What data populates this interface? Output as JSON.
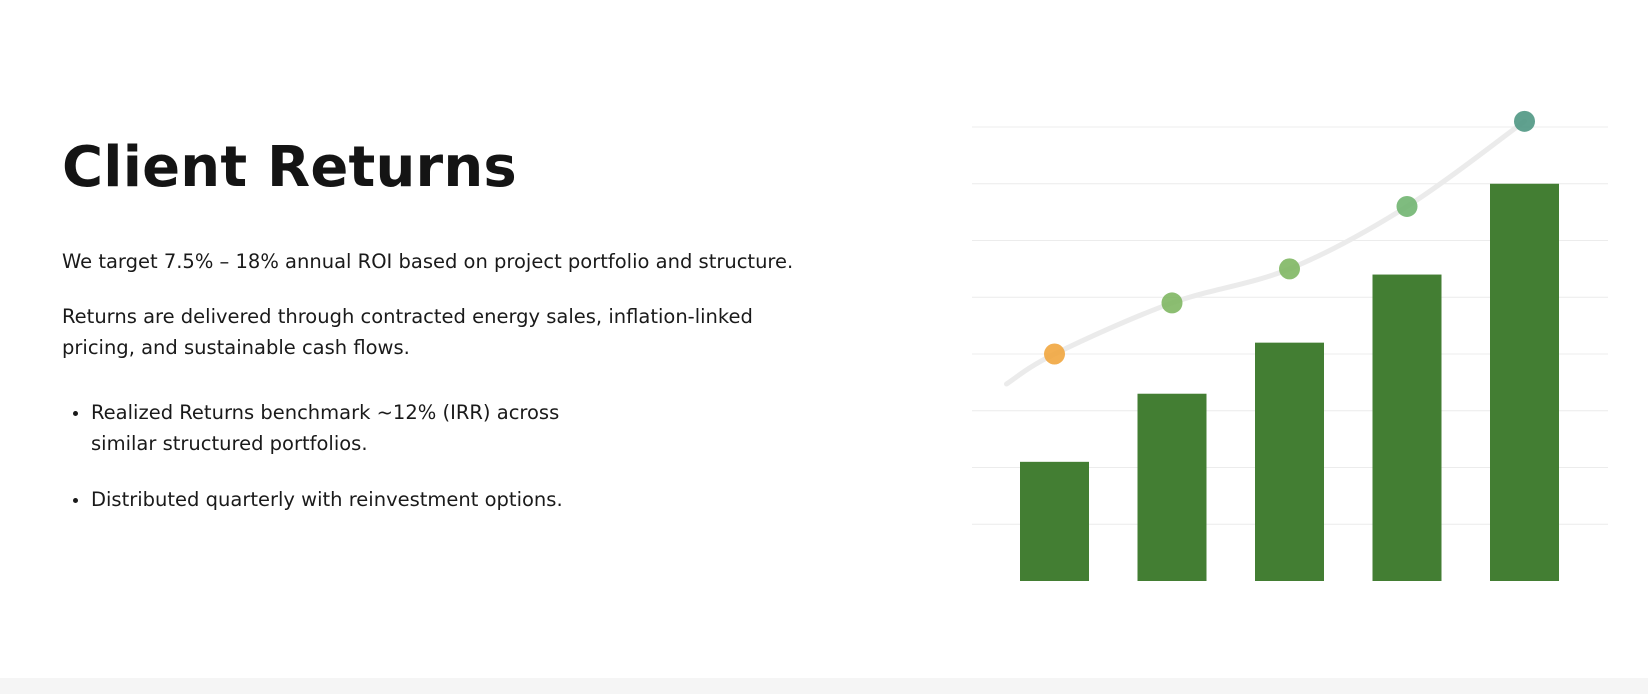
{
  "section": {
    "title": "Client Returns",
    "paragraphs": [
      "We target 7.5% – 18% annual ROI based on project portfolio and structure.",
      "Returns are delivered through contracted energy sales, inflation-linked pricing, and sustainable cash flows."
    ],
    "bullets": [
      "Realized Returns benchmark ~12% (IRR) across similar structured portfolios.",
      "Distributed quarterly with reinvestment options."
    ]
  },
  "chart_data": {
    "type": "bar",
    "values": [
      21,
      33,
      42,
      54,
      70
    ],
    "ylim": [
      0,
      80
    ],
    "grid": true,
    "trend_line": {
      "type": "line",
      "values": [
        40,
        49,
        55,
        66,
        81
      ],
      "point_colors": [
        "#f0a43a",
        "#7cb55e",
        "#7cb55e",
        "#6db36d",
        "#4a9480"
      ],
      "line_color": "#ebebeb"
    },
    "colors": {
      "bar": "#437e33",
      "grid": "#ececec"
    }
  }
}
